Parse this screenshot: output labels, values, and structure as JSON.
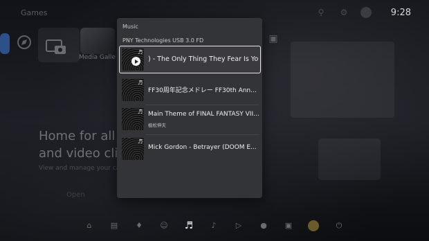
{
  "background": {
    "section_title": "Games",
    "tile_label": "Media Galle",
    "hero_lines": [
      "Home for all yo",
      "and video clips"
    ],
    "hero_sub": "View and manage your ca",
    "hero_button": "Open"
  },
  "clock": "9:28",
  "panel": {
    "heading": "Music",
    "source": "PNY Technologies USB 3.0 FD",
    "tracks": [
      {
        "title": ") - The Only Thing They Fear Is You",
        "artist": ""
      },
      {
        "title": "FF30周年記念メドレー  FF30th Ann...",
        "artist": ""
      },
      {
        "title": "Main Theme of FINAL FANTASY VII...",
        "artist": "植松伸夫"
      },
      {
        "title": "Mick Gordon -  Betrayer (DOOM E...",
        "artist": ""
      }
    ]
  },
  "icons": {
    "note": "♬",
    "dock": [
      "home-icon",
      "game-library-icon",
      "notifications-icon",
      "game-base-icon",
      "music-icon",
      "sound-output-icon",
      "volume-icon",
      "mic-icon",
      "controller-icon",
      "avatar-icon",
      "power-icon"
    ]
  },
  "colors": {
    "panel_bg": "#343539",
    "selected_border": "#e8e8e8"
  }
}
